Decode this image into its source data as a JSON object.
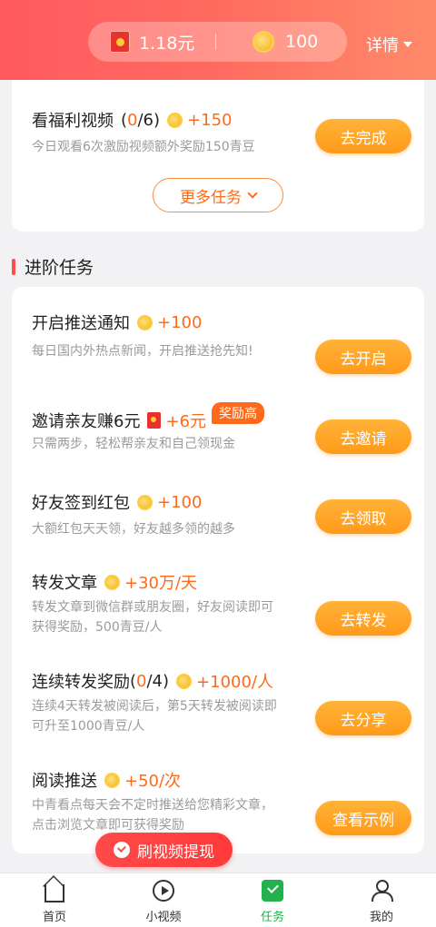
{
  "header": {
    "cash_balance": "1.18元",
    "coin_balance": "100",
    "detail_label": "详情"
  },
  "top_card": {
    "task": {
      "title": "看福利视频",
      "progress_open": "(",
      "progress_cur": "0",
      "progress_rest": " /6)",
      "reward": "+150",
      "desc": "今日观看6次激励视频额外奖励150青豆",
      "button": "去完成"
    },
    "more_label": "更多任务"
  },
  "section": {
    "title": "进阶任务"
  },
  "tasks": [
    {
      "title": "开启推送通知",
      "reward": "+100",
      "reward_type": "coin",
      "desc": "每日国内外热点新闻，开启推送抢先知!",
      "button": "去开启"
    },
    {
      "title": "邀请亲友赚6元",
      "reward": "+6元",
      "reward_type": "redpack",
      "badge": "奖励高",
      "desc": "只需两步，轻松帮亲友和自己领现金",
      "button": "去邀请"
    },
    {
      "title": "好友签到红包",
      "reward": "+100",
      "reward_type": "coin",
      "desc": "大额红包天天领，好友越多领的越多",
      "button": "去领取"
    },
    {
      "title": "转发文章",
      "reward": "+30万/天",
      "reward_type": "coin",
      "desc": "转发文章到微信群或朋友圈，好友阅读即可获得奖励，500青豆/人",
      "button": "去转发"
    },
    {
      "title": "连续转发奖励",
      "progress_open": " (",
      "progress_cur": "0",
      "progress_rest": " /4)",
      "reward": "+1000/人",
      "reward_type": "coin",
      "desc": "连续4天转发被阅读后，第5天转发被阅读即可升至1000青豆/人",
      "button": "去分享"
    },
    {
      "title": "阅读推送",
      "reward": "+50/次",
      "reward_type": "coin",
      "desc": "中青看点每天会不定时推送给您精彩文章，点击浏览文章即可获得奖励",
      "button": "查看示例"
    }
  ],
  "float_pill": {
    "label": "刷视频提现"
  },
  "tabbar": {
    "items": [
      {
        "label": "首页",
        "icon": "home-icon"
      },
      {
        "label": "小视频",
        "icon": "play-icon"
      },
      {
        "label": "任务",
        "icon": "task-check-icon",
        "active": true
      },
      {
        "label": "我的",
        "icon": "user-icon"
      }
    ]
  },
  "colors": {
    "accent": "#ff6a1a",
    "header": "#ff5a5f",
    "tab_active": "#22b14c",
    "button": "#ffa024"
  }
}
